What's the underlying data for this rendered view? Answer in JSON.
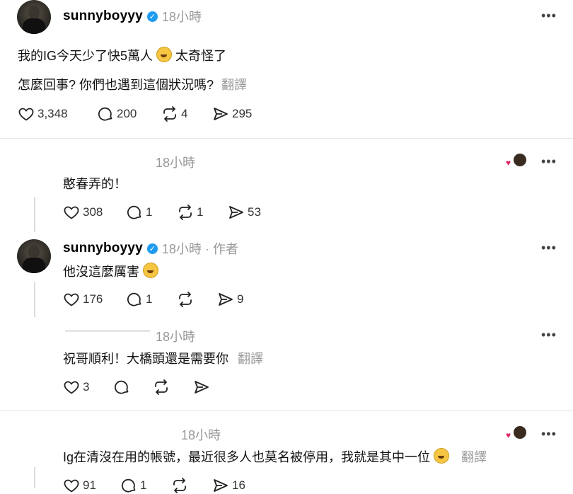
{
  "main_post": {
    "username": "sunnyboyyy",
    "time": "18小時",
    "line1": "我的IG今天少了快5萬人",
    "line1_tail": "太奇怪了",
    "line2": "怎麼回事? 你們也遇到這個狀況嗎?",
    "translate": "翻譯",
    "likes": "3,348",
    "replies": "200",
    "reposts": "4",
    "shares": "295"
  },
  "reply1": {
    "time": "18小時",
    "text": "憨春弄的！",
    "likes": "308",
    "replies": "1",
    "reposts": "1",
    "shares": "53"
  },
  "reply1_author": {
    "username": "sunnyboyyy",
    "meta": "18小時 · 作者",
    "text": "他沒這麼厲害",
    "likes": "176",
    "replies": "1",
    "shares": "9"
  },
  "reply2": {
    "time": "18小時",
    "text": "祝哥順利！大橋頭還是需要你",
    "translate": "翻譯",
    "likes": "3"
  },
  "reply3": {
    "time": "18小時",
    "text": "Ig在清沒在用的帳號，最近很多人也莫名被停用，我就是其中一位",
    "translate": "翻譯",
    "likes": "91",
    "replies": "1",
    "shares": "16"
  },
  "ui": {
    "more": "•••",
    "verified_mark": "✓"
  }
}
